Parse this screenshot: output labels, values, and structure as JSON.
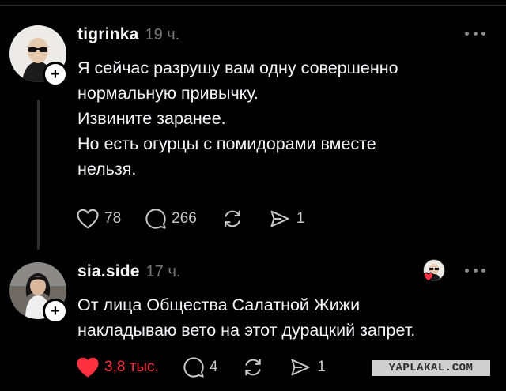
{
  "posts": [
    {
      "username": "tigrinka",
      "time": "19 ч.",
      "lines": [
        "Я сейчас разрушу вам одну совершенно",
        "нормальную привычку.",
        "Извините заранее.",
        "Но есть огурцы с помидорами вместе",
        "нельзя."
      ],
      "likes": "78",
      "comments": "266",
      "shares": "1",
      "liked": false
    },
    {
      "username": "sia.side",
      "time": "17 ч.",
      "lines": [
        "От лица Общества Салатной Жижи",
        "накладываю вето на этот дурацкий запрет."
      ],
      "likes": "3,8 тыс.",
      "comments": "4",
      "shares": "1",
      "liked": true
    }
  ],
  "watermark": "YAPLAKAL.COM",
  "icons": {
    "like": "heart-icon",
    "comment": "comment-bubble-icon",
    "repost": "repost-icon",
    "share": "send-icon",
    "more": "more-dots-icon",
    "follow": "plus-icon"
  },
  "colors": {
    "background": "#000000",
    "liked": "#ff3040",
    "muted": "#777777"
  }
}
